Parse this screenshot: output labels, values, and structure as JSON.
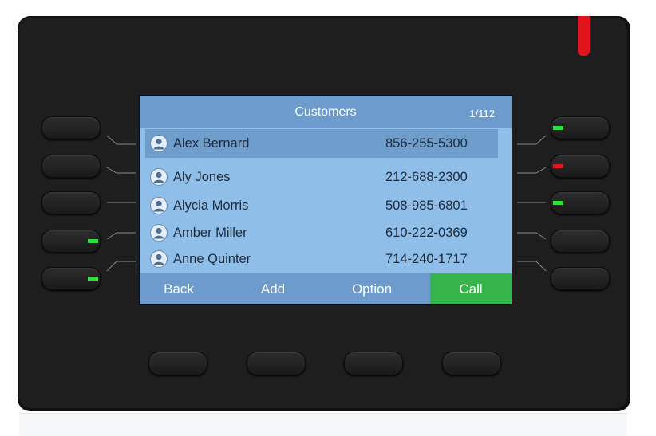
{
  "screen": {
    "title": "Customers",
    "counter": "1/112",
    "contacts": [
      {
        "name": "Alex Bernard",
        "number": "856-255-5300",
        "selected": true
      },
      {
        "name": "Aly Jones",
        "number": "212-688-2300",
        "selected": false
      },
      {
        "name": "Alycia Morris",
        "number": "508-985-6801",
        "selected": false
      },
      {
        "name": "Amber Miller",
        "number": "610-222-0369",
        "selected": false
      },
      {
        "name": "Anne Quinter",
        "number": "714-240-1717",
        "selected": false
      }
    ],
    "softkeys": {
      "back": "Back",
      "add": "Add",
      "option": "Option",
      "call": "Call"
    }
  },
  "line_keys": {
    "left": [
      "off",
      "off",
      "off",
      "green",
      "green"
    ],
    "right": [
      "green",
      "red",
      "green",
      "off",
      "off"
    ]
  },
  "colors": {
    "screen_bg": "#8fbfe8",
    "header_bg": "#6d9ccc",
    "selected_row": "#6f9dcc",
    "call_key": "#37b44a",
    "led_green": "#2ee03a",
    "led_red": "#e3141b",
    "message_indicator": "#e1141b"
  },
  "icons": {
    "contact_avatar": "person-icon"
  }
}
